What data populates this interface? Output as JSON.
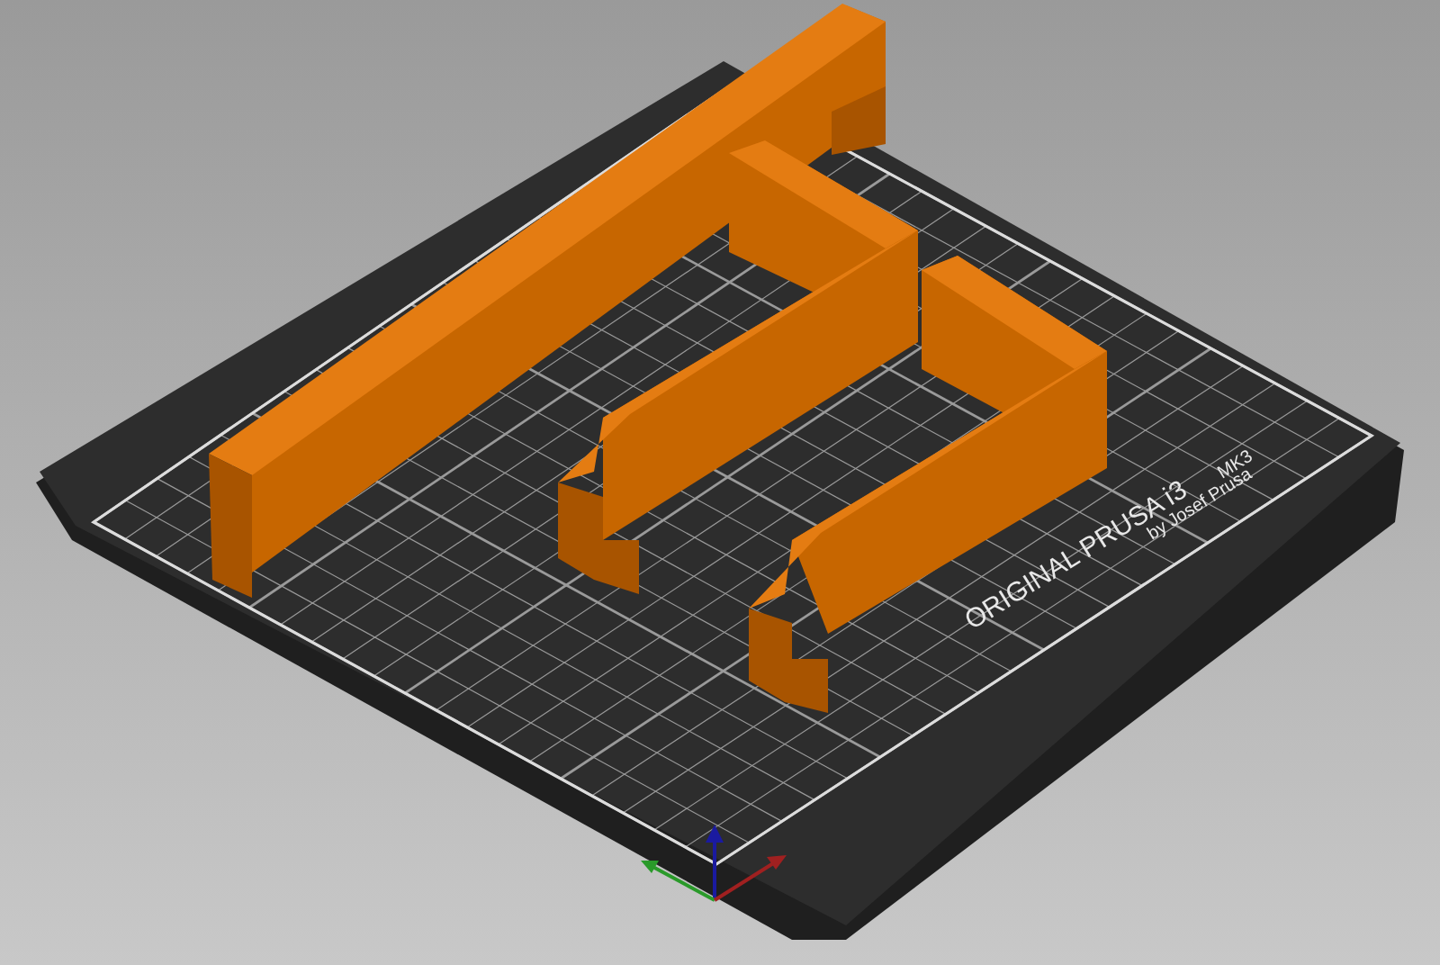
{
  "viewport": {
    "bed_label": {
      "brand": "ORIGINAL PRUSA i3",
      "model": "MK3",
      "credit": "by Josef Prusa"
    }
  }
}
